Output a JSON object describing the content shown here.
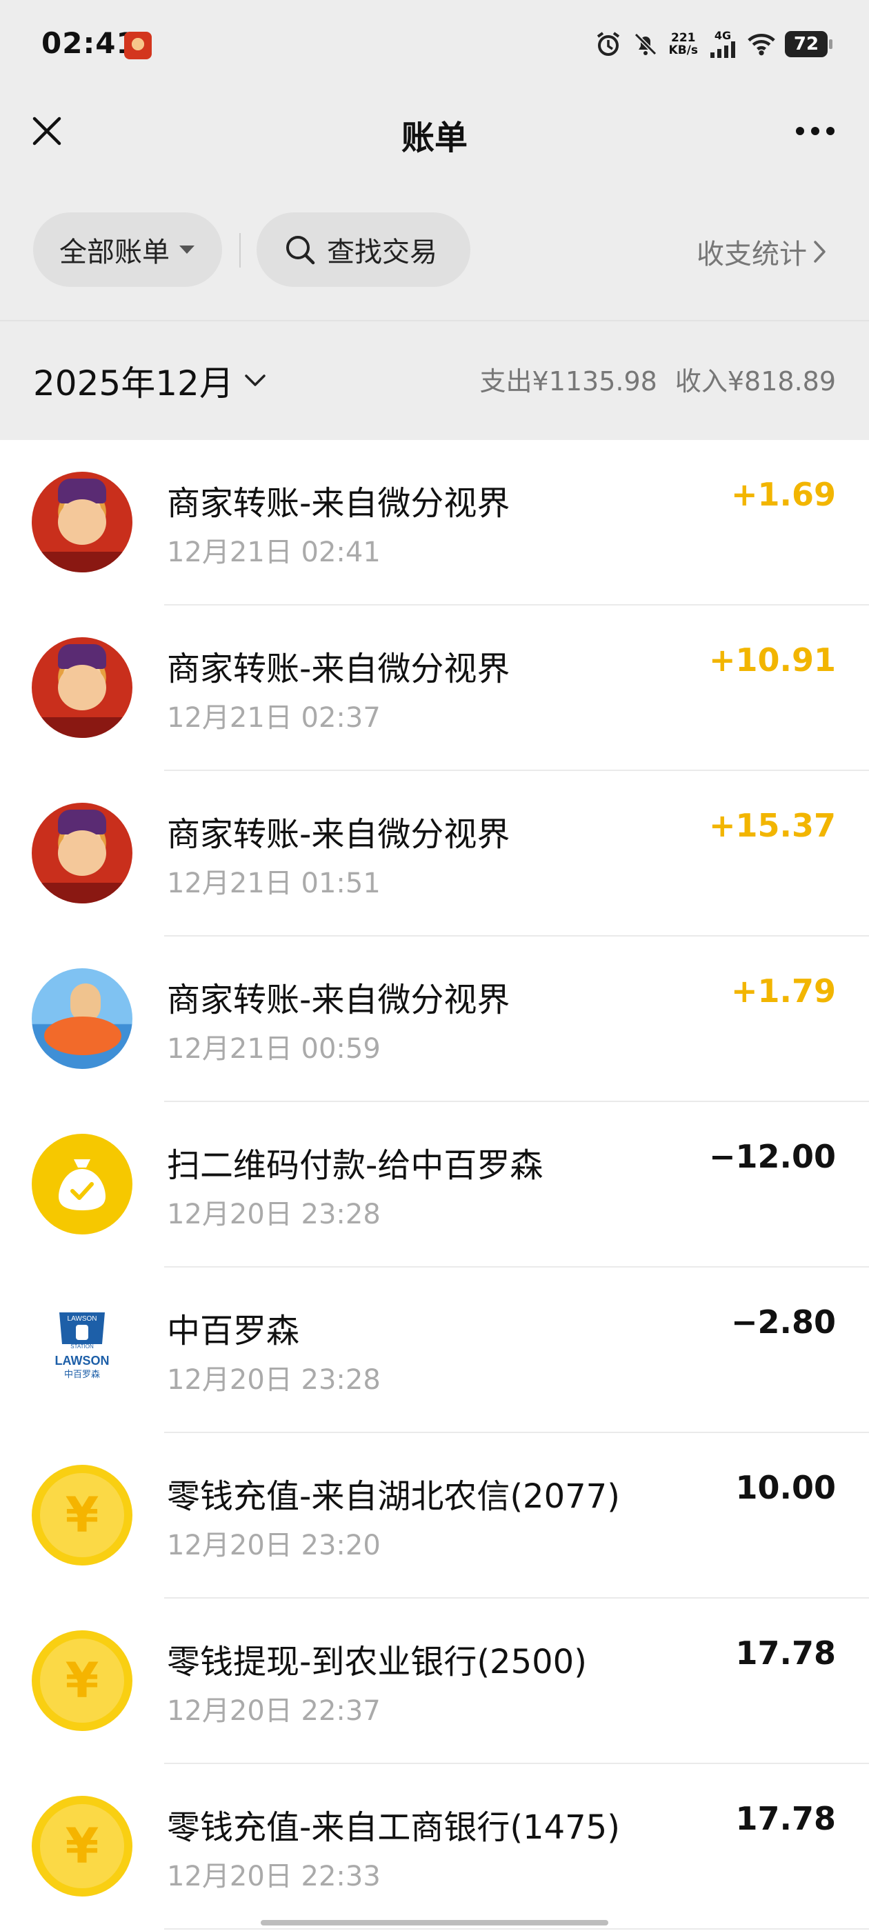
{
  "status_bar": {
    "time": "02:41",
    "net_speed_value": "221",
    "net_speed_unit": "KB/s",
    "network": "4G",
    "battery": "72"
  },
  "nav": {
    "title": "账单"
  },
  "filters": {
    "all_bills": "全部账单",
    "search": "查找交易",
    "stats": "收支统计"
  },
  "month_bar": {
    "month": "2025年12月",
    "expense": "支出¥1135.98",
    "income": "收入¥818.89"
  },
  "transactions": [
    {
      "title": "商家转账-来自微分视界",
      "time": "12月21日 02:41",
      "amount": "+1.69"
    },
    {
      "title": "商家转账-来自微分视界",
      "time": "12月21日 02:37",
      "amount": "+10.91"
    },
    {
      "title": "商家转账-来自微分视界",
      "time": "12月21日 01:51",
      "amount": "+15.37"
    },
    {
      "title": "商家转账-来自微分视界",
      "time": "12月21日 00:59",
      "amount": "+1.79"
    },
    {
      "title": "扫二维码付款-给中百罗森",
      "time": "12月20日 23:28",
      "amount": "−12.00"
    },
    {
      "title": "中百罗森",
      "time": "12月20日 23:28",
      "amount": "−2.80",
      "logo_text_1": "LAWSON",
      "logo_text_2": "STATION",
      "logo_text_3": "LAWSON",
      "logo_text_4": "中百罗森"
    },
    {
      "title": "零钱充值-来自湖北农信(2077)",
      "time": "12月20日 23:20",
      "amount": "10.00"
    },
    {
      "title": "零钱提现-到农业银行(2500)",
      "time": "12月20日 22:37",
      "amount": "17.78"
    },
    {
      "title": "零钱充值-来自工商银行(1475)",
      "time": "12月20日 22:33",
      "amount": "17.78"
    }
  ],
  "icons": {
    "yuan": "¥"
  },
  "colors": {
    "income": "#f2b500",
    "accent_yellow": "#f6c800"
  }
}
